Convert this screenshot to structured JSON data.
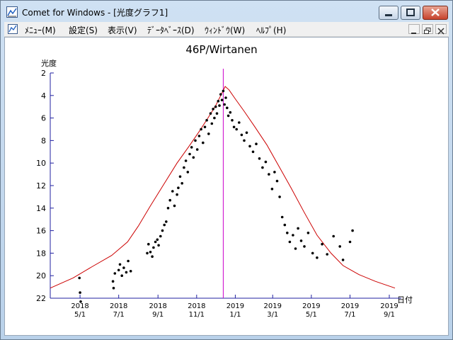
{
  "window": {
    "title": "Comet for Windows - [光度グラフ1]",
    "icon": "chart-icon",
    "controls": [
      "minimize-icon",
      "maximize-icon",
      "close-icon"
    ]
  },
  "menubar": {
    "items": [
      "ﾒﾆｭｰ(M)",
      "設定(S)",
      "表示(V)",
      "ﾃﾞｰﾀﾍﾞｰｽ(D)",
      "ｳｨﾝﾄﾞｳ(W)",
      "ﾍﾙﾌﾟ(H)"
    ],
    "mdi_controls": [
      "mdi-minimize-icon",
      "mdi-restore-icon",
      "mdi-close-icon"
    ]
  },
  "chart_data": {
    "type": "scatter",
    "title": "46P/Wirtanen",
    "ylabel": "光度",
    "xlabel": "日付",
    "y_inverted": true,
    "ylim": [
      22,
      2
    ],
    "yticks": [
      2,
      4,
      6,
      8,
      10,
      12,
      14,
      16,
      18,
      20,
      22
    ],
    "xlim": [
      "2018-03-15",
      "2019-09-20"
    ],
    "xticks": [
      {
        "date": "2018-05-01",
        "year": "2018",
        "md": "5/1"
      },
      {
        "date": "2018-07-01",
        "year": "2018",
        "md": "7/1"
      },
      {
        "date": "2018-09-01",
        "year": "2018",
        "md": "9/1"
      },
      {
        "date": "2018-11-01",
        "year": "2018",
        "md": "11/1"
      },
      {
        "date": "2019-01-01",
        "year": "2019",
        "md": "1/1"
      },
      {
        "date": "2019-03-01",
        "year": "2019",
        "md": "3/1"
      },
      {
        "date": "2019-05-01",
        "year": "2019",
        "md": "5/1"
      },
      {
        "date": "2019-07-01",
        "year": "2019",
        "md": "7/1"
      },
      {
        "date": "2019-09-01",
        "year": "2019",
        "md": "9/1"
      }
    ],
    "perihelion_marker": {
      "date": "2018-12-13",
      "color": "#cc00cc"
    },
    "predicted_curve": {
      "color": "#cc0000",
      "x": [
        "2018-03-15",
        "2018-04-20",
        "2018-05-20",
        "2018-06-20",
        "2018-07-15",
        "2018-08-01",
        "2018-08-20",
        "2018-09-10",
        "2018-10-01",
        "2018-10-20",
        "2018-11-05",
        "2018-11-20",
        "2018-12-01",
        "2018-12-10",
        "2018-12-16",
        "2018-12-22",
        "2019-01-01",
        "2019-01-15",
        "2019-02-01",
        "2019-02-20",
        "2019-03-10",
        "2019-03-30",
        "2019-04-20",
        "2019-05-10",
        "2019-06-01",
        "2019-06-20",
        "2019-07-15",
        "2019-08-10",
        "2019-09-10"
      ],
      "y": [
        21.1,
        20.2,
        19.2,
        18.2,
        17.0,
        15.6,
        13.8,
        11.9,
        10.0,
        8.5,
        7.2,
        5.9,
        4.9,
        3.9,
        3.2,
        3.5,
        4.3,
        5.4,
        6.8,
        8.4,
        10.2,
        12.2,
        14.4,
        16.4,
        18.0,
        19.1,
        19.9,
        20.5,
        21.1
      ],
      "marker_color": "#000000"
    },
    "observations": {
      "color": "#000000",
      "x": [
        "2018-04-30",
        "2018-05-01",
        "2018-05-02",
        "2018-06-22",
        "2018-06-23",
        "2018-06-25",
        "2018-07-01",
        "2018-07-03",
        "2018-07-06",
        "2018-07-09",
        "2018-07-13",
        "2018-07-16",
        "2018-07-20",
        "2018-08-15",
        "2018-08-17",
        "2018-08-20",
        "2018-08-23",
        "2018-08-25",
        "2018-08-28",
        "2018-08-31",
        "2018-09-02",
        "2018-09-05",
        "2018-09-08",
        "2018-09-11",
        "2018-09-14",
        "2018-09-17",
        "2018-09-20",
        "2018-09-24",
        "2018-09-27",
        "2018-10-01",
        "2018-10-03",
        "2018-10-06",
        "2018-10-09",
        "2018-10-12",
        "2018-10-15",
        "2018-10-18",
        "2018-10-21",
        "2018-10-24",
        "2018-10-27",
        "2018-10-30",
        "2018-11-02",
        "2018-11-05",
        "2018-11-08",
        "2018-11-11",
        "2018-11-14",
        "2018-11-17",
        "2018-11-20",
        "2018-11-23",
        "2018-11-25",
        "2018-11-27",
        "2018-11-29",
        "2018-12-01",
        "2018-12-03",
        "2018-12-05",
        "2018-12-07",
        "2018-12-09",
        "2018-12-11",
        "2018-12-13",
        "2018-12-15",
        "2018-12-17",
        "2018-12-19",
        "2018-12-21",
        "2018-12-24",
        "2018-12-27",
        "2018-12-30",
        "2019-01-03",
        "2019-01-07",
        "2019-01-11",
        "2019-01-15",
        "2019-01-19",
        "2019-01-24",
        "2019-01-29",
        "2019-02-03",
        "2019-02-08",
        "2019-02-13",
        "2019-02-18",
        "2019-02-23",
        "2019-02-28",
        "2019-03-04",
        "2019-03-08",
        "2019-03-12",
        "2019-03-16",
        "2019-03-20",
        "2019-03-24",
        "2019-03-28",
        "2019-04-02",
        "2019-04-06",
        "2019-04-10",
        "2019-04-15",
        "2019-04-20",
        "2019-04-26",
        "2019-05-03",
        "2019-05-10",
        "2019-05-18",
        "2019-05-26",
        "2019-06-05",
        "2019-06-15",
        "2019-06-20",
        "2019-07-01",
        "2019-07-05"
      ],
      "y": [
        20.2,
        21.5,
        22.3,
        20.5,
        21.1,
        19.8,
        19.5,
        19.0,
        20.0,
        19.3,
        19.7,
        18.7,
        19.6,
        18.0,
        17.2,
        17.9,
        18.3,
        17.5,
        17.0,
        16.8,
        17.3,
        16.5,
        16.0,
        15.5,
        15.2,
        14.0,
        13.3,
        12.5,
        13.8,
        12.8,
        12.2,
        11.2,
        11.8,
        10.4,
        9.8,
        10.8,
        9.2,
        8.6,
        9.5,
        8.0,
        8.8,
        7.6,
        7.0,
        8.2,
        6.8,
        6.2,
        7.4,
        5.6,
        6.5,
        5.2,
        6.0,
        5.0,
        5.6,
        4.5,
        4.9,
        3.9,
        4.4,
        3.6,
        4.8,
        4.2,
        5.1,
        5.8,
        5.5,
        6.2,
        6.8,
        7.0,
        6.4,
        7.5,
        8.0,
        7.3,
        8.5,
        9.0,
        8.3,
        9.6,
        10.4,
        9.9,
        11.0,
        12.3,
        10.8,
        11.6,
        13.0,
        14.8,
        15.5,
        16.2,
        17.0,
        16.4,
        17.6,
        15.8,
        16.9,
        17.4,
        16.2,
        18.0,
        18.4,
        17.2,
        18.1,
        16.5,
        17.4,
        18.6,
        17.0,
        16.0
      ]
    }
  }
}
